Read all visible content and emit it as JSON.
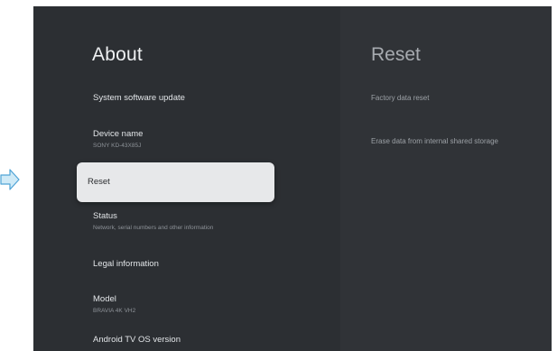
{
  "about": {
    "title": "About",
    "items": [
      {
        "label": "System software update",
        "sub": ""
      },
      {
        "label": "Device name",
        "sub": "SONY KD-43X85J"
      },
      {
        "label": "Reset",
        "sub": ""
      },
      {
        "label": "Status",
        "sub": "Network, serial numbers and other information"
      },
      {
        "label": "Legal information",
        "sub": ""
      },
      {
        "label": "Model",
        "sub": "BRAVIA 4K VH2"
      },
      {
        "label": "Android TV OS version",
        "sub": ""
      }
    ],
    "selected_index": 2
  },
  "reset": {
    "title": "Reset",
    "options": [
      {
        "label": "Factory data reset"
      },
      {
        "label": "Erase data from internal shared storage"
      }
    ]
  },
  "colors": {
    "background": "#2c2f33",
    "right_pane": "#303337",
    "selected_item": "#e7e8ea",
    "pointer_fill": "#cfeaf7",
    "pointer_stroke": "#4fa3d6"
  },
  "icons": {
    "pointer": "right-arrow-icon"
  }
}
